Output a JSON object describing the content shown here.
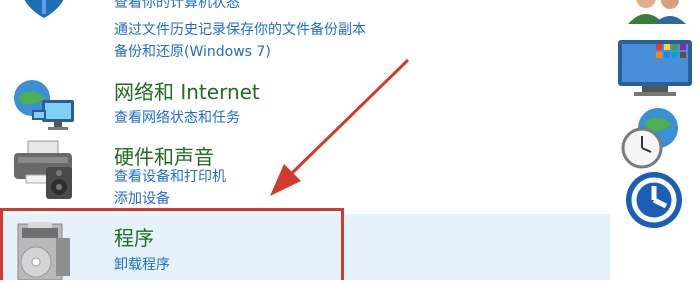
{
  "categories": [
    {
      "title": "",
      "links": [
        "查看你的计算机状态",
        "通过文件历史记录保存你的文件备份副本",
        "备份和还原(Windows 7)"
      ],
      "icon": "system-security-icon"
    },
    {
      "title": "网络和 Internet",
      "links": [
        "查看网络状态和任务"
      ],
      "icon": "network-icon"
    },
    {
      "title": "硬件和声音",
      "links": [
        "查看设备和打印机",
        "添加设备"
      ],
      "icon": "hardware-sound-icon"
    },
    {
      "title": "程序",
      "links": [
        "卸载程序"
      ],
      "icon": "programs-icon",
      "highlighted": true
    }
  ],
  "right_icons": [
    "user-accounts-icon",
    "appearance-icon",
    "clock-region-icon",
    "ease-of-access-icon"
  ],
  "colors": {
    "title_green": "#1e6e1e",
    "link_blue": "#1f6ed4",
    "highlight_bg": "#e5f1fb",
    "annotation_red": "#d23a2e"
  }
}
